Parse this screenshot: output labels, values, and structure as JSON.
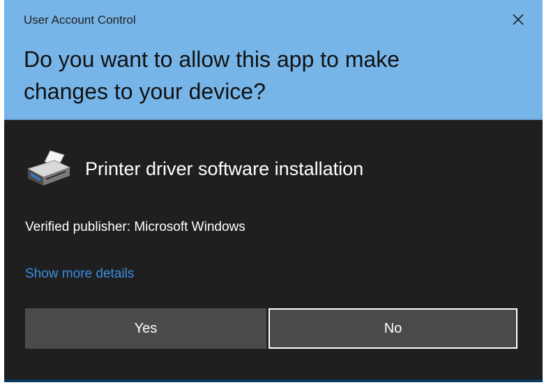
{
  "window": {
    "title": "User Account Control",
    "close_icon": "close-icon"
  },
  "prompt": {
    "question": "Do you want to allow this app to make changes to your device?"
  },
  "app": {
    "icon": "printer-icon",
    "name": "Printer driver software installation"
  },
  "publisher": {
    "text": "Verified publisher: Microsoft Windows"
  },
  "details_link": {
    "label": "Show more details"
  },
  "buttons": {
    "yes_label": "Yes",
    "no_label": "No"
  },
  "colors": {
    "header_bg": "#77b5e8",
    "body_bg": "#1f1f1f",
    "button_bg": "#4a4a4a",
    "link": "#3a8ee0"
  }
}
